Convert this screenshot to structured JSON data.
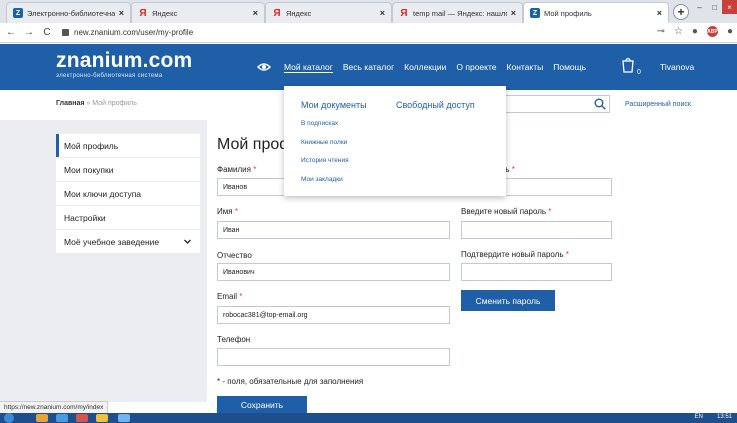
{
  "browser": {
    "tabs": [
      {
        "title": "Электронно-библиотечная си",
        "favicon": "znanium-favicon-icon",
        "close": "×"
      },
      {
        "title": "Яндекс",
        "favicon": "yandex-favicon-icon",
        "close": "×"
      },
      {
        "title": "Яндекс",
        "favicon": "yandex-favicon-icon",
        "close": "×"
      },
      {
        "title": "temp mail — Яндекс: нашлось",
        "favicon": "yandex-favicon-icon",
        "close": "×"
      },
      {
        "title": "Мой профиль",
        "favicon": "znanium-favicon-icon",
        "close": "×"
      }
    ],
    "url": "new.znanium.com/user/my-profile",
    "status_url": "https://new.znanium.com/my/index",
    "icons": [
      "back-icon",
      "forward-icon",
      "reload-icon",
      "lock-icon",
      "key-icon",
      "star-icon",
      "profile-icon"
    ]
  },
  "header": {
    "logo": "znanium.com",
    "logo_sub": "электронно-библиотечная система",
    "nav": [
      "Мой каталог",
      "Весь каталог",
      "Коллекции",
      "О проекте",
      "Контакты",
      "Помощь"
    ],
    "cart_count": "0",
    "username": "Tivanova",
    "brand_color": "#1e5fa8"
  },
  "breadcrumb": {
    "home": "Главная",
    "separator": "»",
    "current": "Мой профиль"
  },
  "search": {
    "advanced_label": "Расширенный поиск"
  },
  "dropdown": {
    "col1": "Мои документы",
    "col2": "Свободный доступ",
    "items": [
      "В подписках",
      "Книжные полки",
      "История чтения",
      "Мои закладки"
    ]
  },
  "sidebar": {
    "items": [
      "Мой профиль",
      "Мои покупки",
      "Мои ключи доступа",
      "Настройки",
      "Моё учебное заведение"
    ]
  },
  "profile": {
    "title": "Мой проф",
    "required_mark": "*",
    "lastname_label": "Фамилия",
    "lastname_value": "Иванов",
    "firstname_label": "Имя",
    "firstname_value": "Иван",
    "middlename_label": "Отчество",
    "middlename_value": "Иванович",
    "email_label": "Email",
    "email_value": "robocac381@top-email.org",
    "phone_label": "Телефон",
    "phone_value": "",
    "required_note": "* - поля, обязательные для заполнения",
    "save_label": "Сохранить"
  },
  "password": {
    "old_label": "роль",
    "new_label": "Введите новый пароль",
    "confirm_label": "Подтвердите новый пароль",
    "change_label": "Сменить пароль"
  },
  "taskbar": {
    "lang": "EN",
    "time": "13:51"
  }
}
